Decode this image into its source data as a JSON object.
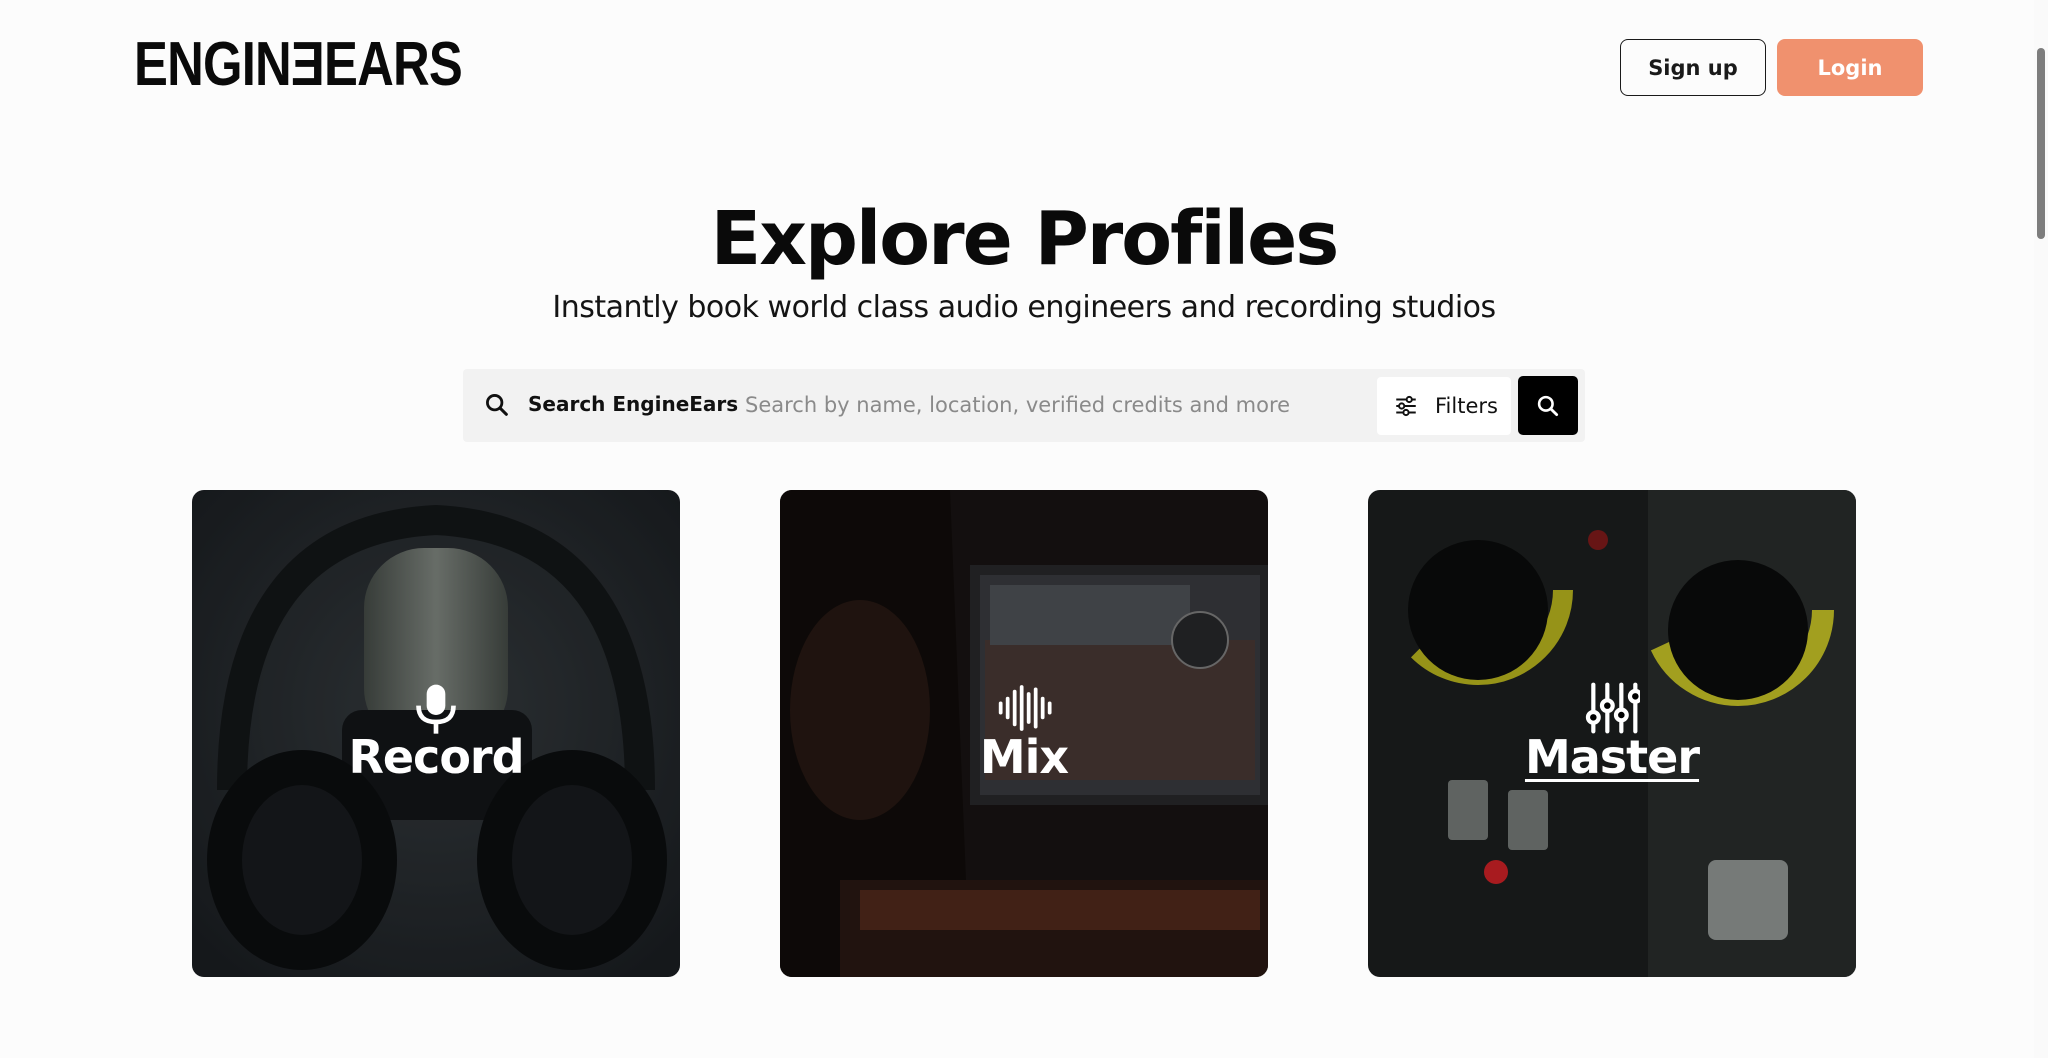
{
  "header": {
    "logo_text": "ENGINƎEARS",
    "signup_label": "Sign up",
    "login_label": "Login"
  },
  "hero": {
    "title": "Explore Profiles",
    "subtitle": "Instantly book world class audio engineers and recording studios"
  },
  "search": {
    "label": "Search EngineEars",
    "placeholder": "Search by name, location, verified credits and more",
    "value": "",
    "filters_label": "Filters",
    "icon": "search-icon",
    "filters_icon": "sliders-icon"
  },
  "cards": [
    {
      "label": "Record",
      "icon": "microphone-icon"
    },
    {
      "label": "Mix",
      "icon": "waveform-icon"
    },
    {
      "label": "Master",
      "icon": "faders-icon"
    }
  ],
  "colors": {
    "accent": "#f0916e",
    "background": "#fcfcfc",
    "text": "#0a0a0a"
  }
}
